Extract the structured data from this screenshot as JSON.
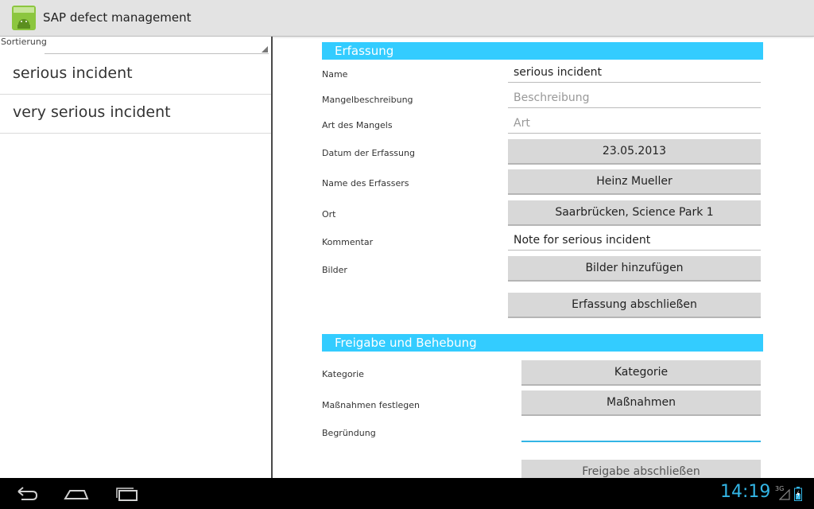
{
  "app": {
    "title": "SAP defect management"
  },
  "sidebar": {
    "sort_label": "Sortierung",
    "items": [
      {
        "label": "serious incident"
      },
      {
        "label": "very serious incident"
      }
    ]
  },
  "capture": {
    "header": "Erfassung",
    "fields": {
      "name": {
        "label": "Name",
        "value": "serious incident"
      },
      "description": {
        "label": "Mangelbeschreibung",
        "placeholder": "Beschreibung"
      },
      "type": {
        "label": "Art des Mangels",
        "placeholder": "Art"
      },
      "date": {
        "label": "Datum der Erfassung",
        "value": "23.05.2013"
      },
      "recorder": {
        "label": "Name des Erfassers",
        "value": "Heinz Mueller"
      },
      "location": {
        "label": "Ort",
        "value": "Saarbrücken, Science Park 1"
      },
      "comment": {
        "label": "Kommentar",
        "value": "Note for serious incident"
      },
      "images": {
        "label": "Bilder",
        "button": "Bilder hinzufügen"
      }
    },
    "finish_button": "Erfassung abschließen"
  },
  "release": {
    "header": "Freigabe und Behebung",
    "fields": {
      "category": {
        "label": "Kategorie",
        "button": "Kategorie"
      },
      "measures": {
        "label": "Maßnahmen festlegen",
        "button": "Maßnahmen"
      },
      "reason": {
        "label": "Begründung",
        "value": ""
      }
    },
    "finish_button": "Freigabe abschließen"
  },
  "status": {
    "time": "14:19",
    "network": "3G"
  },
  "colors": {
    "accent": "#33ccff",
    "clock": "#33b5e5"
  }
}
